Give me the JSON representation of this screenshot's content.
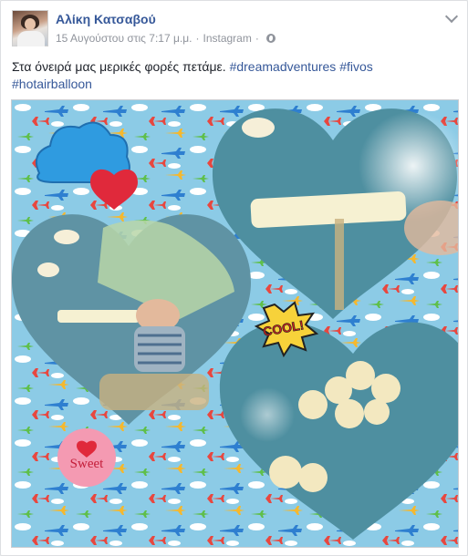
{
  "post": {
    "author": "Αλίκη Κατσαβού",
    "date": "15 Αυγούστου στις 7:17 μ.μ.",
    "separator": "·",
    "source": "Instagram",
    "text_main": "Στα όνειρά μας μερικές φορές πετάμε.",
    "hashtags": [
      "#dreamadventures",
      "#fivos",
      "#hotairballoon"
    ]
  },
  "photo": {
    "stickers": {
      "cool": "COOL!",
      "sweet": "Sweet"
    },
    "colors": {
      "background": "#8ccbe6",
      "heart_overlay": "#4e8fa0",
      "cloud_sticker": "#2f9be0",
      "heart_sticker": "#e0293b",
      "sweet_badge": "#f49ab2"
    }
  },
  "icons": {
    "privacy": "globe-icon",
    "options": "chevron-down-icon"
  },
  "colors": {
    "author_link": "#365899",
    "meta_text": "#90949c",
    "body_text": "#1d2129"
  }
}
